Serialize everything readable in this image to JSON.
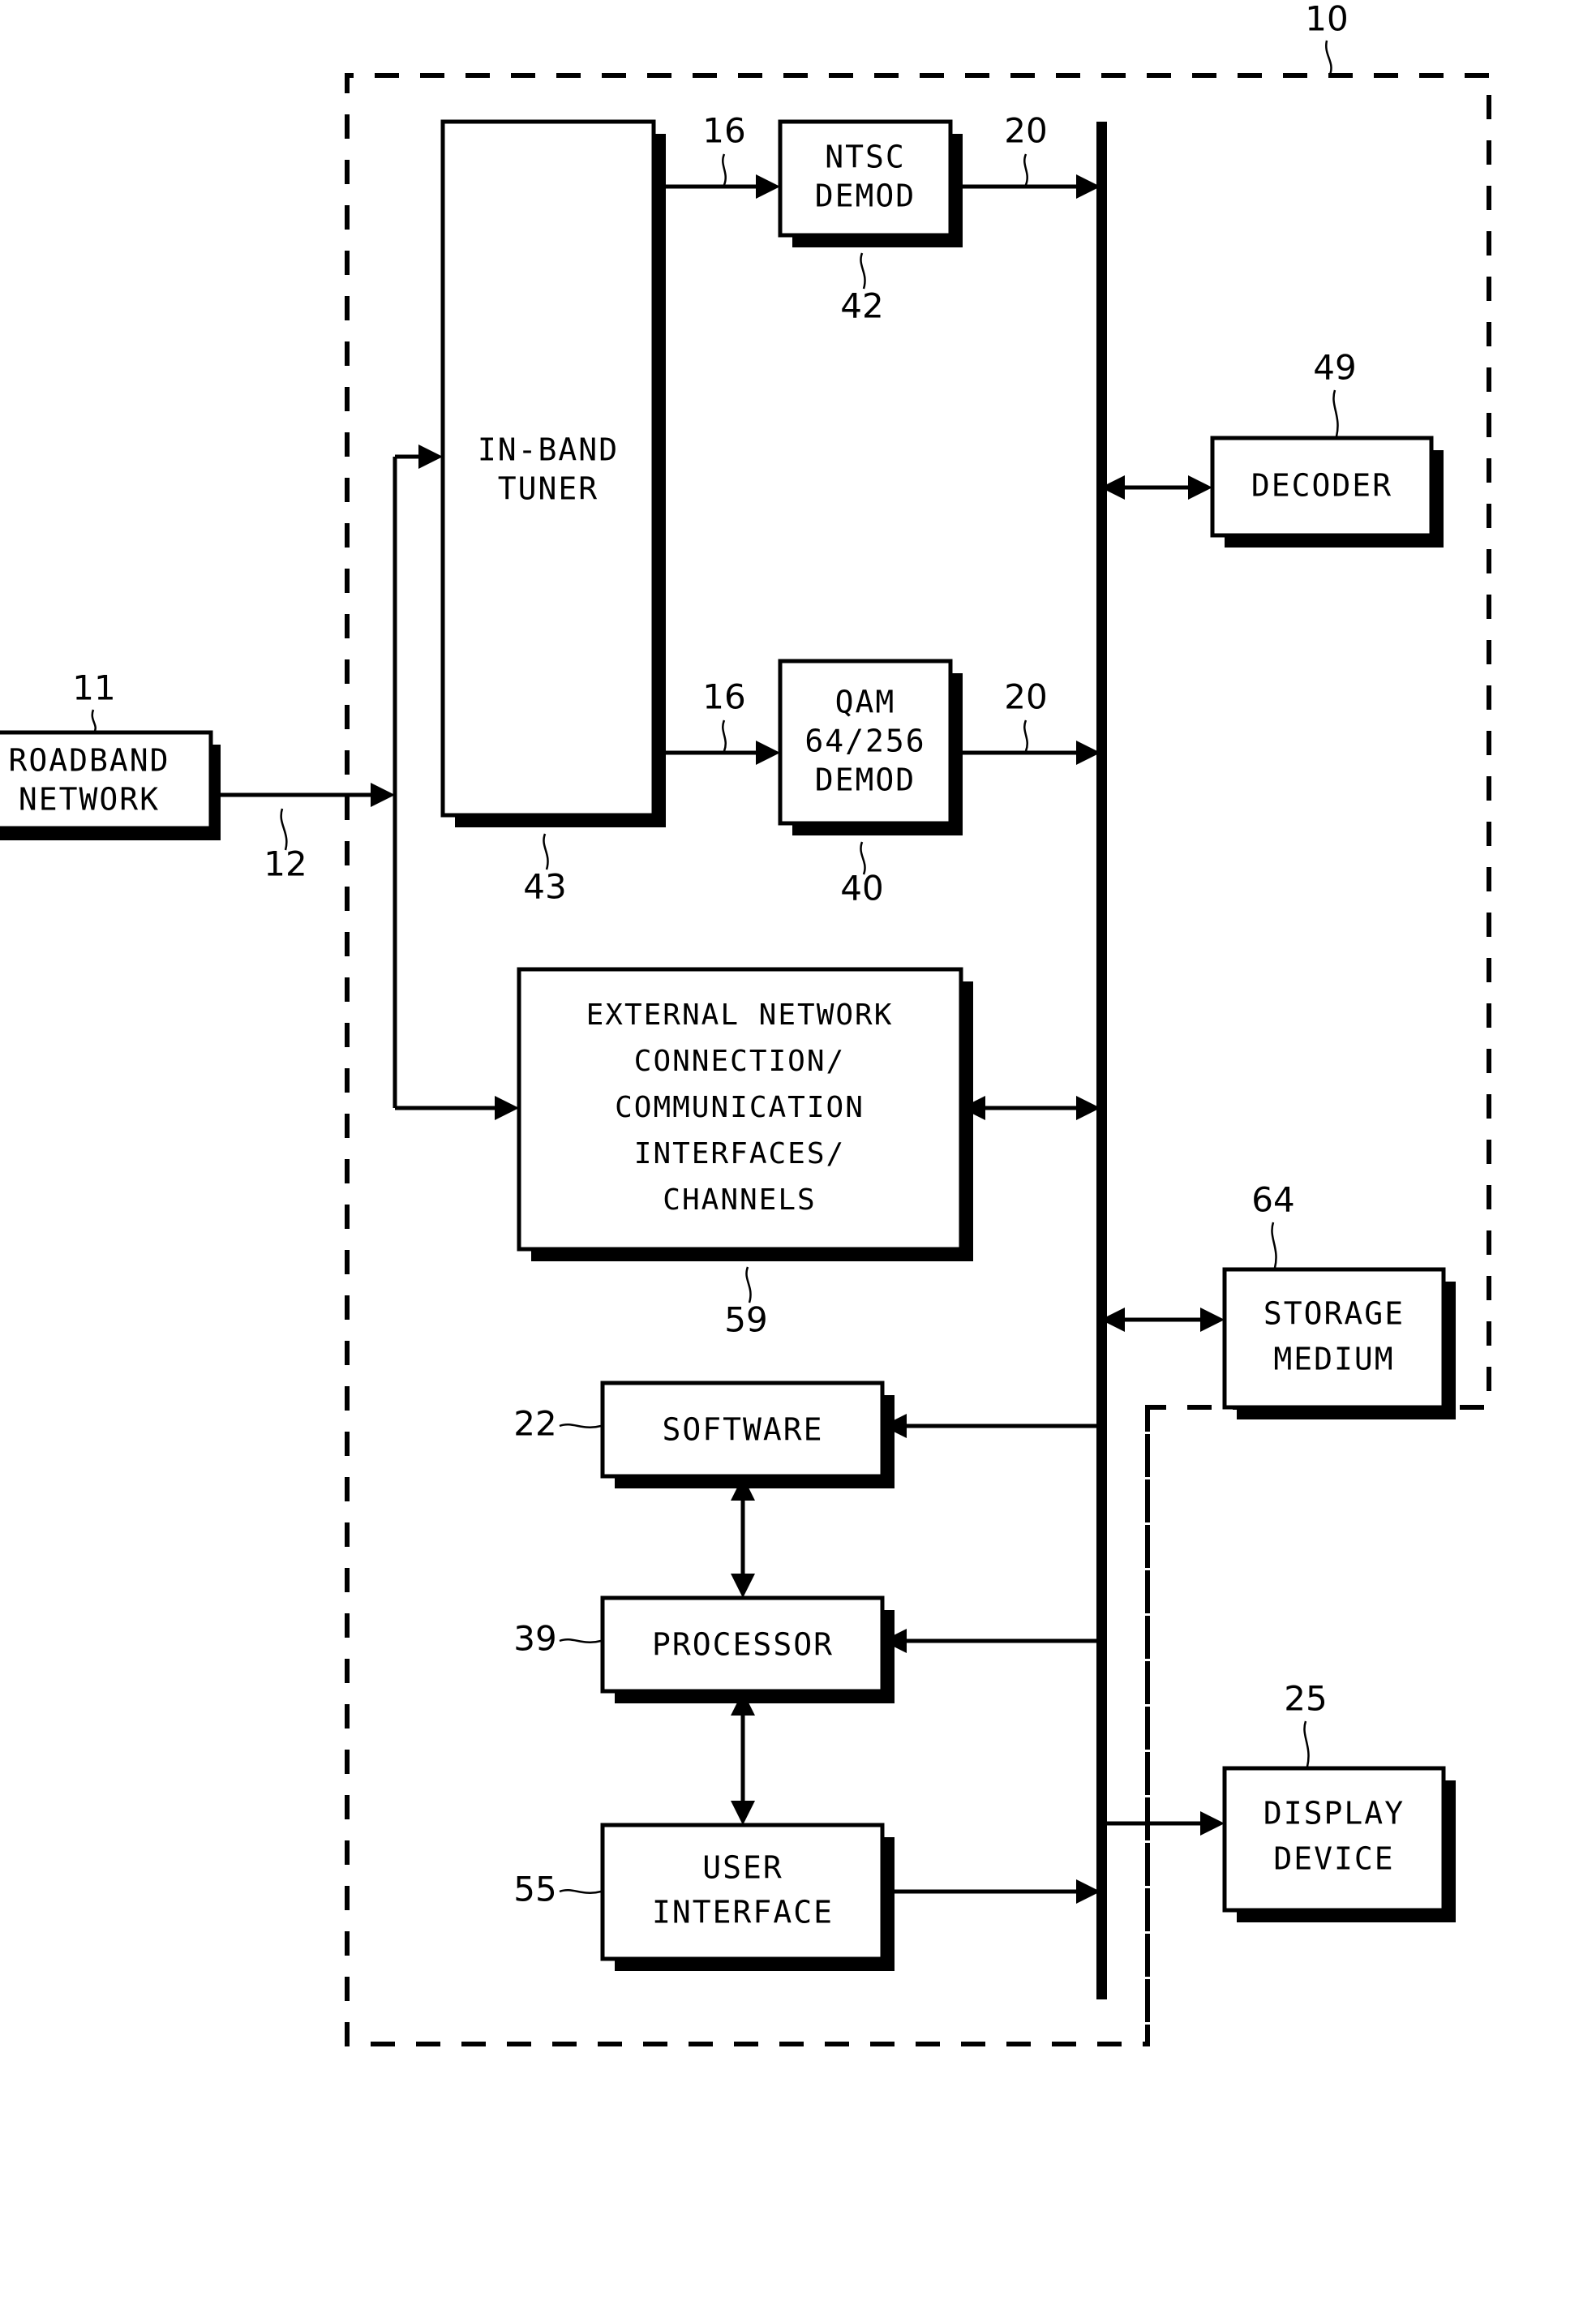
{
  "figure": {
    "type": "patent-block-diagram",
    "background": "#ffffff",
    "ink": "#000000"
  },
  "boxes": {
    "broadband_network": {
      "label_line1": "ROADBAND",
      "label_line2": "NETWORK",
      "ref": "11"
    },
    "in_band_tuner": {
      "label_line1": "IN-BAND",
      "label_line2": "TUNER",
      "ref": "43"
    },
    "ntsc_demod": {
      "label_line1": "NTSC",
      "label_line2": "DEMOD",
      "ref": "42"
    },
    "qam_demod": {
      "label_line1": "QAM",
      "label_line2": "64/256",
      "label_line3": "DEMOD",
      "ref": "40"
    },
    "external_network": {
      "label_line1": "EXTERNAL  NETWORK",
      "label_line2": "CONNECTION/",
      "label_line3": "COMMUNICATION",
      "label_line4": "INTERFACES/",
      "label_line5": "CHANNELS",
      "ref": "59"
    },
    "decoder": {
      "label_line1": "DECODER",
      "ref": "49"
    },
    "storage_medium": {
      "label_line1": "STORAGE",
      "label_line2": "MEDIUM",
      "ref": "64"
    },
    "software": {
      "label_line1": "SOFTWARE",
      "ref": "22"
    },
    "processor": {
      "label_line1": "PROCESSOR",
      "ref": "39"
    },
    "user_interface": {
      "label_line1": "USER",
      "label_line2": "INTERFACE",
      "ref": "55"
    },
    "display_device": {
      "label_line1": "DISPLAY",
      "label_line2": "DEVICE",
      "ref": "25"
    }
  },
  "enclosure": {
    "main_ref": "10"
  },
  "signal_refs": {
    "input_line": "12",
    "tuner_out_top": "16",
    "tuner_out_bottom": "16",
    "ntsc_out": "20",
    "qam_out": "20"
  }
}
